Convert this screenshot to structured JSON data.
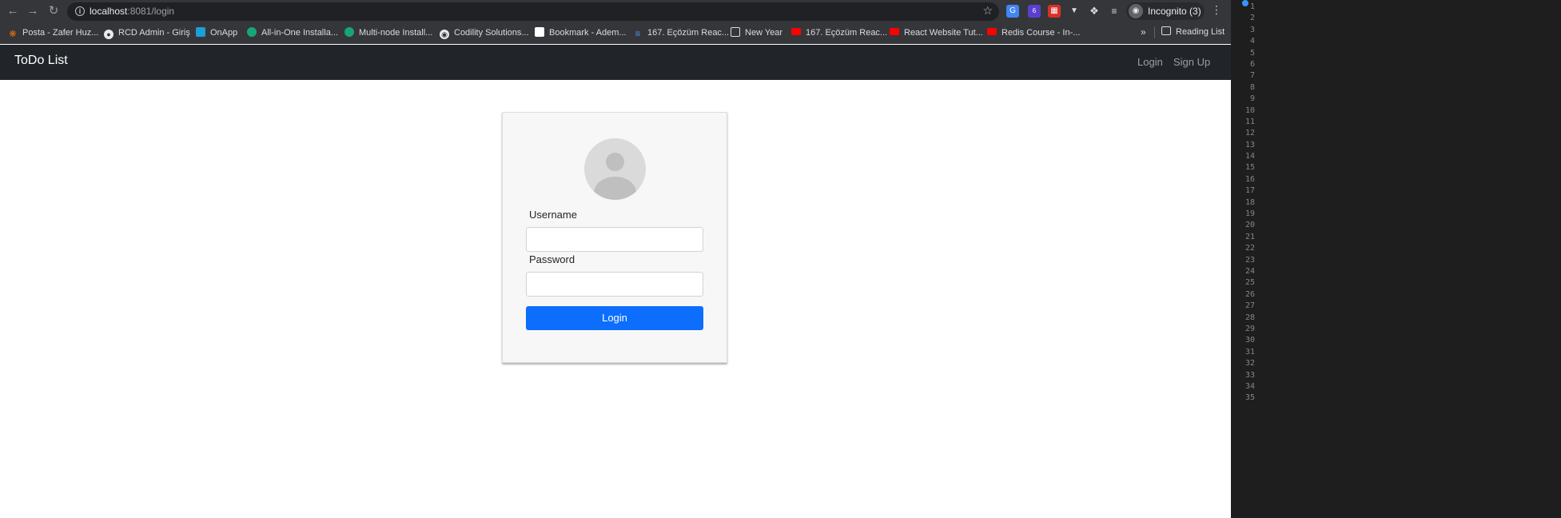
{
  "browser": {
    "url_host": "localhost",
    "url_path": ":8081/login",
    "incognito_label": "Incognito (3)",
    "extension_badge": "6",
    "bookmarks": [
      {
        "label": "Posta - Zafer Huz...",
        "icon": "posta-icon",
        "color": "#e8710a"
      },
      {
        "label": "RCD Admin - Giriş",
        "icon": "globe-icon",
        "color": "#e8eaed"
      },
      {
        "label": "OnApp",
        "icon": "onapp-icon",
        "color": "#1a9fd6"
      },
      {
        "label": "All-in-One Installa...",
        "icon": "installer-icon",
        "color": "#17a673"
      },
      {
        "label": "Multi-node Install...",
        "icon": "installer-icon",
        "color": "#17a673"
      },
      {
        "label": "Codility Solutions...",
        "icon": "github-icon",
        "color": "#e8eaed"
      },
      {
        "label": "Bookmark - Adem...",
        "icon": "page-icon",
        "color": "#ffffff"
      },
      {
        "label": "167. Eçözüm Reac...",
        "icon": "lines-icon",
        "color": "#4b8ef1"
      },
      {
        "label": "New Year",
        "icon": "folder-icon",
        "color": "#dadce0"
      },
      {
        "label": "167. Eçözüm Reac...",
        "icon": "youtube-icon",
        "color": "#ff0000"
      },
      {
        "label": "React Website Tut...",
        "icon": "youtube-icon",
        "color": "#ff0000"
      },
      {
        "label": "Redis Course - In-...",
        "icon": "youtube-icon",
        "color": "#ff0000"
      }
    ],
    "reading_list_label": "Reading List"
  },
  "navbar": {
    "brand": "ToDo List",
    "login_link": "Login",
    "signup_link": "Sign Up"
  },
  "login_form": {
    "username_label": "Username",
    "username_value": "",
    "password_label": "Password",
    "password_value": "",
    "submit_label": "Login"
  },
  "devtools": {
    "line_numbers": [
      "1",
      "2",
      "3",
      "4",
      "5",
      "6",
      "7",
      "8",
      "9",
      "10",
      "11",
      "12",
      "13",
      "14",
      "15",
      "16",
      "17",
      "18",
      "19",
      "20",
      "21",
      "22",
      "23",
      "24",
      "25",
      "26",
      "27",
      "28",
      "29",
      "30",
      "31",
      "32",
      "33",
      "34",
      "35"
    ]
  },
  "colors": {
    "navbar_bg": "#212529",
    "primary_button": "#0d6efd",
    "card_bg": "#f7f7f7"
  }
}
